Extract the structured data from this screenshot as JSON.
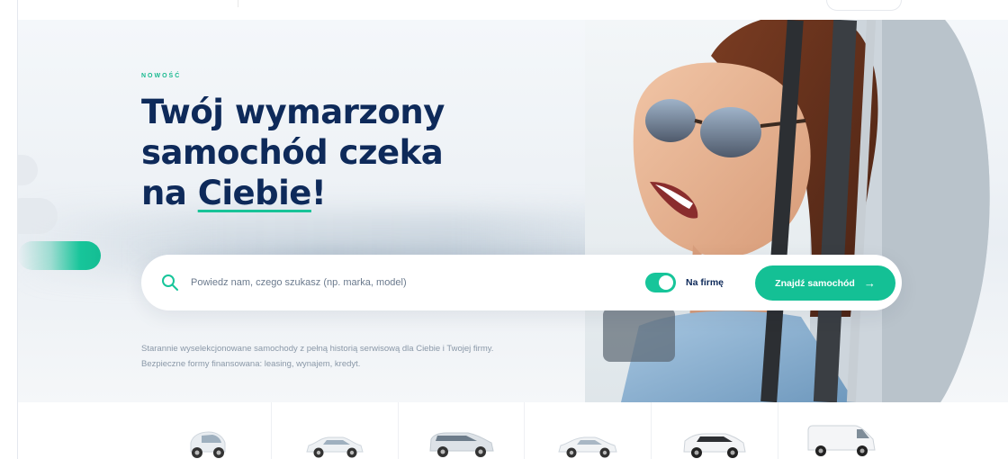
{
  "hero": {
    "eyebrow": "NOWOŚĆ",
    "headline_line1": "Twój wymarzony",
    "headline_line2": "samochód czeka",
    "headline_line3_prefix": "na ",
    "headline_line3_highlight": "Ciebie",
    "headline_line3_suffix": "!",
    "description": "Starannie wyselekcjonowane samochody z pełną historią serwisową dla Ciebie i Twojej firmy. Bezpieczne formy finansowana: leasing, wynajem, kredyt."
  },
  "search": {
    "placeholder": "Powiedz nam, czego szukasz (np. marka, model)",
    "icon": "search-icon",
    "toggle_label": "Na firmę",
    "toggle_on": true,
    "button_label": "Znajdź samochód",
    "button_arrow": "→"
  },
  "categories": [
    {
      "icon": "city-car-icon"
    },
    {
      "icon": "sedan-car-icon"
    },
    {
      "icon": "hatchback-car-icon"
    },
    {
      "icon": "compact-car-icon"
    },
    {
      "icon": "suv-car-icon"
    },
    {
      "icon": "van-icon"
    }
  ],
  "colors": {
    "accent": "#17c59a",
    "navy": "#0e2a5a",
    "muted_text": "#8a98a8"
  }
}
